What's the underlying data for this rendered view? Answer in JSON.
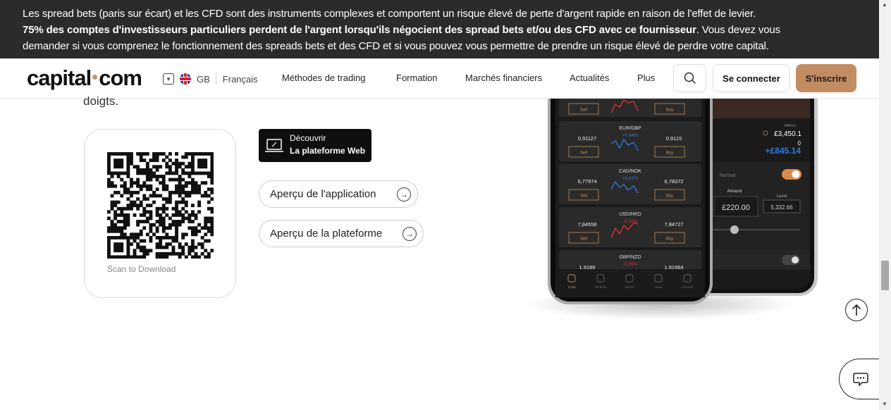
{
  "risk_banner": {
    "line1": "Les spread bets (paris sur écart) et les CFD sont des instruments complexes et comportent un risque élevé de perte d'argent rapide en raison de l'effet de levier.",
    "line2_bold": "75% des comptes d'investisseurs particuliers perdent de l'argent lorsqu'ils négocient des spread bets et/ou des CFD avec ce fournisseur",
    "line2_rest": ". Vous devez vous",
    "line3": "demander si vous comprenez le fonctionnement des spreads bets et des CFD et si vous pouvez vous permettre de prendre un risque élevé de perdre votre capital."
  },
  "header": {
    "logo_left": "capital",
    "logo_right": "com",
    "region": "GB",
    "language": "Français",
    "nav": [
      "Méthodes de trading",
      "Formation",
      "Marchés financiers",
      "Actualités",
      "Plus"
    ],
    "login_label": "Se connecter",
    "signup_label": "S'inscrire"
  },
  "content": {
    "body_fragment": "doigts.",
    "qr_caption": "Scan to Download",
    "web_button": {
      "line1": "Découvrir",
      "line2": "La plateforme Web"
    },
    "app_preview_label": "Aperçu de l'application",
    "platform_preview_label": "Aperçu de la plateforme"
  },
  "phone_front": {
    "rows": [
      {
        "pair": "EUR/GBP",
        "sell": "0,91127",
        "change": "+0,94%",
        "buy": "0,9115",
        "direction": "up"
      },
      {
        "pair": "CAD/NOK",
        "sell": "6,77974",
        "change": "+0,02%",
        "buy": "6,78372",
        "direction": "up"
      },
      {
        "pair": "USD/HKD",
        "sell": "7,84556",
        "change": "-0,01%",
        "buy": "7,84727",
        "direction": "down"
      },
      {
        "pair": "GBP/NZD",
        "sell": "1,9189",
        "change": "-0,55%",
        "buy": "1,91964",
        "direction": "down"
      }
    ],
    "sell_label": "Sell",
    "buy_label": "Buy",
    "tabs": [
      "Trade",
      "Portfolio",
      "Search",
      "News",
      "Account"
    ]
  },
  "phone_back": {
    "margin_label": "MARGI",
    "balance": "£3,450.1",
    "zero": "0",
    "pnl": "+£845.14",
    "mode": "Normal",
    "amount_label": "Amount",
    "level_label": "Level",
    "amount_value": "£220.00",
    "level_value": "5,332.66"
  },
  "colors": {
    "banner_bg": "#2b2b2b",
    "accent": "#c28c63",
    "positive": "#2f7be0",
    "negative": "#e0322f"
  }
}
